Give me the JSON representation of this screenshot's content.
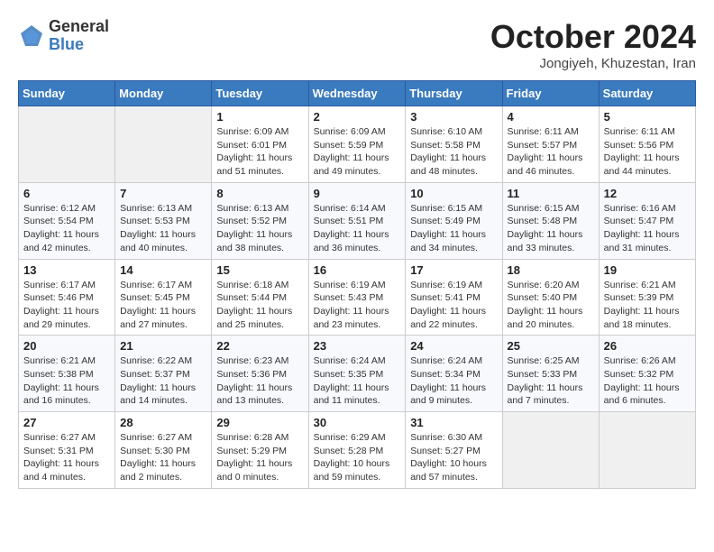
{
  "logo": {
    "general": "General",
    "blue": "Blue"
  },
  "title": "October 2024",
  "subtitle": "Jongiyeh, Khuzestan, Iran",
  "days_header": [
    "Sunday",
    "Monday",
    "Tuesday",
    "Wednesday",
    "Thursday",
    "Friday",
    "Saturday"
  ],
  "weeks": [
    [
      {
        "day": "",
        "info": ""
      },
      {
        "day": "",
        "info": ""
      },
      {
        "day": "1",
        "info": "Sunrise: 6:09 AM\nSunset: 6:01 PM\nDaylight: 11 hours and 51 minutes."
      },
      {
        "day": "2",
        "info": "Sunrise: 6:09 AM\nSunset: 5:59 PM\nDaylight: 11 hours and 49 minutes."
      },
      {
        "day": "3",
        "info": "Sunrise: 6:10 AM\nSunset: 5:58 PM\nDaylight: 11 hours and 48 minutes."
      },
      {
        "day": "4",
        "info": "Sunrise: 6:11 AM\nSunset: 5:57 PM\nDaylight: 11 hours and 46 minutes."
      },
      {
        "day": "5",
        "info": "Sunrise: 6:11 AM\nSunset: 5:56 PM\nDaylight: 11 hours and 44 minutes."
      }
    ],
    [
      {
        "day": "6",
        "info": "Sunrise: 6:12 AM\nSunset: 5:54 PM\nDaylight: 11 hours and 42 minutes."
      },
      {
        "day": "7",
        "info": "Sunrise: 6:13 AM\nSunset: 5:53 PM\nDaylight: 11 hours and 40 minutes."
      },
      {
        "day": "8",
        "info": "Sunrise: 6:13 AM\nSunset: 5:52 PM\nDaylight: 11 hours and 38 minutes."
      },
      {
        "day": "9",
        "info": "Sunrise: 6:14 AM\nSunset: 5:51 PM\nDaylight: 11 hours and 36 minutes."
      },
      {
        "day": "10",
        "info": "Sunrise: 6:15 AM\nSunset: 5:49 PM\nDaylight: 11 hours and 34 minutes."
      },
      {
        "day": "11",
        "info": "Sunrise: 6:15 AM\nSunset: 5:48 PM\nDaylight: 11 hours and 33 minutes."
      },
      {
        "day": "12",
        "info": "Sunrise: 6:16 AM\nSunset: 5:47 PM\nDaylight: 11 hours and 31 minutes."
      }
    ],
    [
      {
        "day": "13",
        "info": "Sunrise: 6:17 AM\nSunset: 5:46 PM\nDaylight: 11 hours and 29 minutes."
      },
      {
        "day": "14",
        "info": "Sunrise: 6:17 AM\nSunset: 5:45 PM\nDaylight: 11 hours and 27 minutes."
      },
      {
        "day": "15",
        "info": "Sunrise: 6:18 AM\nSunset: 5:44 PM\nDaylight: 11 hours and 25 minutes."
      },
      {
        "day": "16",
        "info": "Sunrise: 6:19 AM\nSunset: 5:43 PM\nDaylight: 11 hours and 23 minutes."
      },
      {
        "day": "17",
        "info": "Sunrise: 6:19 AM\nSunset: 5:41 PM\nDaylight: 11 hours and 22 minutes."
      },
      {
        "day": "18",
        "info": "Sunrise: 6:20 AM\nSunset: 5:40 PM\nDaylight: 11 hours and 20 minutes."
      },
      {
        "day": "19",
        "info": "Sunrise: 6:21 AM\nSunset: 5:39 PM\nDaylight: 11 hours and 18 minutes."
      }
    ],
    [
      {
        "day": "20",
        "info": "Sunrise: 6:21 AM\nSunset: 5:38 PM\nDaylight: 11 hours and 16 minutes."
      },
      {
        "day": "21",
        "info": "Sunrise: 6:22 AM\nSunset: 5:37 PM\nDaylight: 11 hours and 14 minutes."
      },
      {
        "day": "22",
        "info": "Sunrise: 6:23 AM\nSunset: 5:36 PM\nDaylight: 11 hours and 13 minutes."
      },
      {
        "day": "23",
        "info": "Sunrise: 6:24 AM\nSunset: 5:35 PM\nDaylight: 11 hours and 11 minutes."
      },
      {
        "day": "24",
        "info": "Sunrise: 6:24 AM\nSunset: 5:34 PM\nDaylight: 11 hours and 9 minutes."
      },
      {
        "day": "25",
        "info": "Sunrise: 6:25 AM\nSunset: 5:33 PM\nDaylight: 11 hours and 7 minutes."
      },
      {
        "day": "26",
        "info": "Sunrise: 6:26 AM\nSunset: 5:32 PM\nDaylight: 11 hours and 6 minutes."
      }
    ],
    [
      {
        "day": "27",
        "info": "Sunrise: 6:27 AM\nSunset: 5:31 PM\nDaylight: 11 hours and 4 minutes."
      },
      {
        "day": "28",
        "info": "Sunrise: 6:27 AM\nSunset: 5:30 PM\nDaylight: 11 hours and 2 minutes."
      },
      {
        "day": "29",
        "info": "Sunrise: 6:28 AM\nSunset: 5:29 PM\nDaylight: 11 hours and 0 minutes."
      },
      {
        "day": "30",
        "info": "Sunrise: 6:29 AM\nSunset: 5:28 PM\nDaylight: 10 hours and 59 minutes."
      },
      {
        "day": "31",
        "info": "Sunrise: 6:30 AM\nSunset: 5:27 PM\nDaylight: 10 hours and 57 minutes."
      },
      {
        "day": "",
        "info": ""
      },
      {
        "day": "",
        "info": ""
      }
    ]
  ]
}
